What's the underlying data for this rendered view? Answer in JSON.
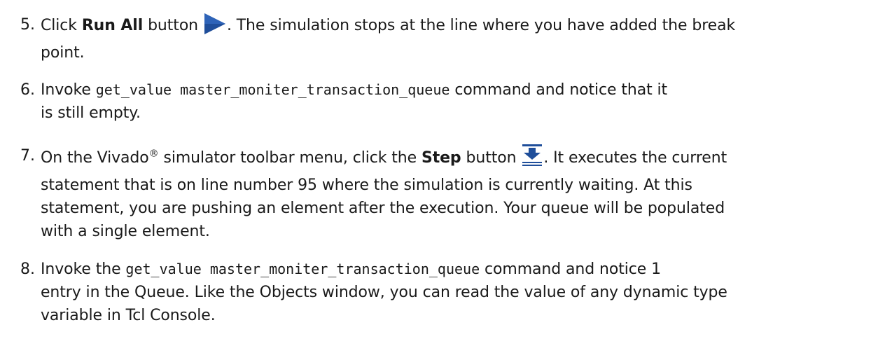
{
  "steps": [
    {
      "number": "5.",
      "prefix": "Click ",
      "bold": "Run All",
      "after_bold": " button",
      "icon": "run-all-icon",
      "suffix": ". The simulation stops at the line where you have added the break",
      "line2": "point."
    },
    {
      "number": "6.",
      "prefix": "Invoke ",
      "code": "get_value master_moniter_transaction_queue",
      "suffix": " command and notice that it",
      "line2": "is still empty."
    },
    {
      "number": "7.",
      "prefix": "On the Vivado",
      "reg": "®",
      "mid": " simulator toolbar menu, click the ",
      "bold": "Step",
      "after_bold": " button",
      "icon": "step-icon",
      "suffix": ". It executes the current",
      "line2": "statement that is on line number 95 where the simulation is currently waiting. At this",
      "line3": "statement, you are pushing an element after the execution. Your queue will be populated",
      "line4": "with a single element."
    },
    {
      "number": "8.",
      "prefix": "Invoke the ",
      "code": "get_value master_moniter_transaction_queue",
      "suffix": " command and notice 1",
      "line2": "entry in the Queue. Like the Objects window, you can read the value of any dynamic type",
      "line3": "variable in Tcl Console."
    }
  ],
  "colors": {
    "icon_blue": "#1f4e9a",
    "text": "#1a1a1a"
  }
}
